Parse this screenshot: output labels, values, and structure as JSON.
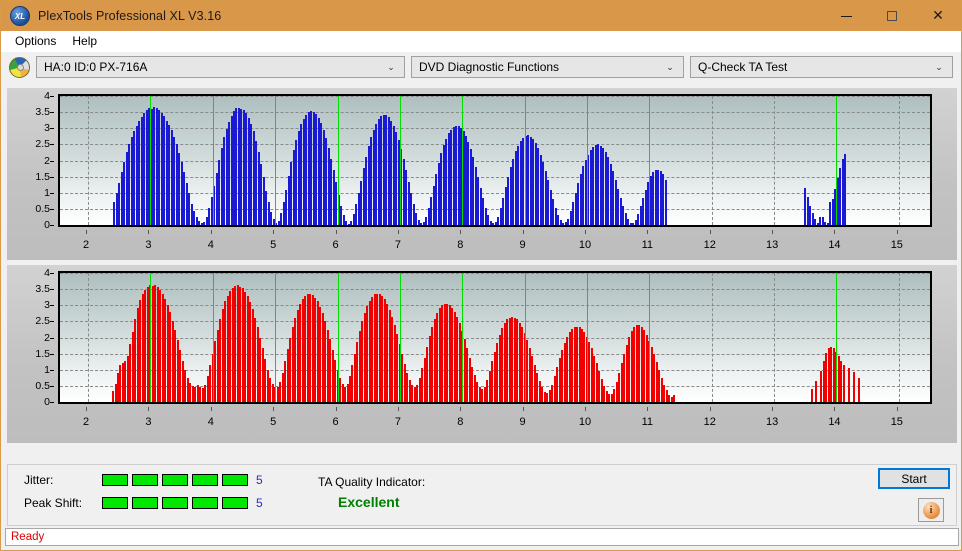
{
  "window": {
    "title": "PlexTools Professional XL V3.16",
    "app_icon": "xl-logo-icon",
    "minimize_label": "—",
    "maximize_label": "□",
    "close_label": "✕"
  },
  "menu": {
    "items": [
      {
        "label": "Options"
      },
      {
        "label": "Help"
      }
    ]
  },
  "toolbar": {
    "drive_icon": "disc-icon",
    "drive": {
      "value": "HA:0 ID:0  PX-716A",
      "arrow": "⌄"
    },
    "function": {
      "value": "DVD Diagnostic Functions",
      "arrow": "⌄"
    },
    "test": {
      "value": "Q-Check TA Test",
      "arrow": "⌄"
    }
  },
  "results": {
    "jitter_label": "Jitter:",
    "jitter_value": "5",
    "jitter_segments": 5,
    "peak_shift_label": "Peak Shift:",
    "peak_shift_value": "5",
    "peak_shift_segments": 5,
    "ta_quality_label": "TA Quality Indicator:",
    "ta_quality_value": "Excellent",
    "start_label": "Start",
    "info_glyph": "i"
  },
  "status": {
    "text": "Ready"
  },
  "colors": {
    "titlebar": "#d9974a",
    "jitter_bar": "#00e800",
    "quality_text": "#008000",
    "status_text": "#e00000",
    "top_series": "#1a1ad4",
    "bottom_series": "#f20000",
    "marker": "#00e000",
    "accent": "#0078d7"
  },
  "chart_data": [
    {
      "type": "bar",
      "title": "Jitter",
      "xlabel": "",
      "ylabel": "",
      "xlim": [
        1.55,
        15.5
      ],
      "ylim": [
        0,
        4
      ],
      "yticks": [
        0,
        0.5,
        1,
        1.5,
        2,
        2.5,
        3,
        3.5,
        4
      ],
      "xticks": [
        2,
        3,
        4,
        5,
        6,
        7,
        8,
        9,
        10,
        11,
        12,
        13,
        14,
        15
      ],
      "grid": true,
      "color": "#1a1ad4",
      "markers": [
        3,
        4,
        5,
        6,
        7,
        8,
        9,
        10,
        11,
        14
      ],
      "bar_width": 0.022,
      "x": [
        2.42,
        2.46,
        2.5,
        2.54,
        2.58,
        2.62,
        2.66,
        2.7,
        2.74,
        2.78,
        2.82,
        2.86,
        2.9,
        2.94,
        2.98,
        3.02,
        3.06,
        3.1,
        3.14,
        3.18,
        3.22,
        3.26,
        3.3,
        3.34,
        3.38,
        3.42,
        3.46,
        3.5,
        3.54,
        3.58,
        3.62,
        3.66,
        3.7,
        3.74,
        3.78,
        3.82,
        3.86,
        3.9,
        3.94,
        3.98,
        4.02,
        4.06,
        4.1,
        4.14,
        4.18,
        4.22,
        4.26,
        4.3,
        4.34,
        4.38,
        4.42,
        4.46,
        4.5,
        4.54,
        4.58,
        4.62,
        4.66,
        4.7,
        4.74,
        4.78,
        4.82,
        4.86,
        4.9,
        4.94,
        4.98,
        5.02,
        5.06,
        5.1,
        5.14,
        5.18,
        5.22,
        5.26,
        5.3,
        5.34,
        5.38,
        5.42,
        5.46,
        5.5,
        5.54,
        5.58,
        5.62,
        5.66,
        5.7,
        5.74,
        5.78,
        5.82,
        5.86,
        5.9,
        5.94,
        5.98,
        6.02,
        6.06,
        6.1,
        6.14,
        6.18,
        6.22,
        6.26,
        6.3,
        6.34,
        6.38,
        6.42,
        6.46,
        6.5,
        6.54,
        6.58,
        6.62,
        6.66,
        6.7,
        6.74,
        6.78,
        6.82,
        6.86,
        6.9,
        6.94,
        6.98,
        7.02,
        7.06,
        7.1,
        7.14,
        7.18,
        7.22,
        7.26,
        7.3,
        7.34,
        7.38,
        7.42,
        7.46,
        7.5,
        7.54,
        7.58,
        7.62,
        7.66,
        7.7,
        7.74,
        7.78,
        7.82,
        7.86,
        7.9,
        7.94,
        7.98,
        8.02,
        8.06,
        8.1,
        8.14,
        8.18,
        8.22,
        8.26,
        8.3,
        8.34,
        8.38,
        8.42,
        8.46,
        8.5,
        8.54,
        8.58,
        8.62,
        8.66,
        8.7,
        8.74,
        8.78,
        8.82,
        8.86,
        8.9,
        8.94,
        8.98,
        9.02,
        9.06,
        9.1,
        9.14,
        9.18,
        9.22,
        9.26,
        9.3,
        9.34,
        9.38,
        9.42,
        9.46,
        9.5,
        9.54,
        9.58,
        9.62,
        9.66,
        9.7,
        9.74,
        9.78,
        9.82,
        9.86,
        9.9,
        9.94,
        9.98,
        10.02,
        10.06,
        10.1,
        10.14,
        10.18,
        10.22,
        10.26,
        10.3,
        10.34,
        10.38,
        10.42,
        10.46,
        10.5,
        10.54,
        10.58,
        10.62,
        10.66,
        10.7,
        10.74,
        10.78,
        10.82,
        10.86,
        10.9,
        10.94,
        10.98,
        11.02,
        11.06,
        11.1,
        11.14,
        11.18,
        11.22,
        11.26,
        13.5,
        13.54,
        13.58,
        13.62,
        13.66,
        13.7,
        13.74,
        13.78,
        13.82,
        13.86,
        13.9,
        13.94,
        13.98,
        14.02,
        14.06,
        14.1,
        14.14
      ],
      "y": [
        0.72,
        0.98,
        1.3,
        1.64,
        1.96,
        2.26,
        2.52,
        2.72,
        2.9,
        3.06,
        3.22,
        3.36,
        3.46,
        3.56,
        3.62,
        3.6,
        3.66,
        3.62,
        3.56,
        3.48,
        3.38,
        3.24,
        3.1,
        2.94,
        2.72,
        2.5,
        2.24,
        1.96,
        1.64,
        1.3,
        0.98,
        0.66,
        0.42,
        0.26,
        0.14,
        0.06,
        0.1,
        0.26,
        0.52,
        0.86,
        1.22,
        1.62,
        2.02,
        2.4,
        2.72,
        2.98,
        3.2,
        3.38,
        3.52,
        3.62,
        3.64,
        3.6,
        3.56,
        3.46,
        3.32,
        3.14,
        2.9,
        2.6,
        2.26,
        1.88,
        1.48,
        1.06,
        0.7,
        0.4,
        0.18,
        0.06,
        0.14,
        0.38,
        0.72,
        1.1,
        1.52,
        1.94,
        2.32,
        2.64,
        2.9,
        3.12,
        3.3,
        3.42,
        3.5,
        3.52,
        3.5,
        3.44,
        3.32,
        3.16,
        2.96,
        2.7,
        2.4,
        2.06,
        1.7,
        1.32,
        0.94,
        0.6,
        0.32,
        0.12,
        0.04,
        0.12,
        0.34,
        0.64,
        1.0,
        1.38,
        1.76,
        2.12,
        2.44,
        2.72,
        2.96,
        3.14,
        3.28,
        3.38,
        3.42,
        3.4,
        3.34,
        3.24,
        3.08,
        2.88,
        2.64,
        2.36,
        2.04,
        1.7,
        1.34,
        1.0,
        0.66,
        0.36,
        0.16,
        0.06,
        0.1,
        0.26,
        0.52,
        0.86,
        1.22,
        1.58,
        1.92,
        2.22,
        2.48,
        2.68,
        2.84,
        2.96,
        3.04,
        3.08,
        3.06,
        3.0,
        2.9,
        2.76,
        2.58,
        2.36,
        2.1,
        1.8,
        1.48,
        1.16,
        0.84,
        0.54,
        0.3,
        0.14,
        0.06,
        0.1,
        0.26,
        0.52,
        0.84,
        1.18,
        1.5,
        1.8,
        2.06,
        2.28,
        2.46,
        2.6,
        2.7,
        2.76,
        2.78,
        2.74,
        2.66,
        2.54,
        2.38,
        2.18,
        1.94,
        1.68,
        1.4,
        1.1,
        0.82,
        0.54,
        0.32,
        0.16,
        0.06,
        0.08,
        0.2,
        0.42,
        0.7,
        1.0,
        1.3,
        1.58,
        1.82,
        2.02,
        2.18,
        2.32,
        2.42,
        2.48,
        2.5,
        2.46,
        2.38,
        2.26,
        2.1,
        1.9,
        1.66,
        1.4,
        1.12,
        0.84,
        0.58,
        0.36,
        0.18,
        0.06,
        0.06,
        0.16,
        0.34,
        0.58,
        0.84,
        1.1,
        1.34,
        1.52,
        1.64,
        1.7,
        1.72,
        1.68,
        1.58,
        1.4,
        1.16,
        0.88,
        0.6,
        0.36,
        0.18,
        0.06,
        0.24,
        0.26,
        0.1,
        0.06,
        0.7,
        0.8,
        1.12,
        1.46,
        1.78,
        2.04,
        2.2,
        2.16,
        2.06,
        1.92,
        1.74,
        1.52,
        1.28,
        1.02,
        0.72,
        0.28,
        0.14
      ]
    },
    {
      "type": "bar",
      "title": "Peak Shift",
      "xlabel": "",
      "ylabel": "",
      "xlim": [
        1.55,
        15.5
      ],
      "ylim": [
        0,
        4
      ],
      "yticks": [
        0,
        0.5,
        1,
        1.5,
        2,
        2.5,
        3,
        3.5,
        4
      ],
      "xticks": [
        2,
        3,
        4,
        5,
        6,
        7,
        8,
        9,
        10,
        11,
        12,
        13,
        14,
        15
      ],
      "grid": true,
      "color": "#f20000",
      "markers": [
        3,
        4,
        5,
        6,
        7,
        8,
        9,
        10,
        11,
        14
      ],
      "bar_width": 0.03,
      "x": [
        2.4,
        2.44,
        2.48,
        2.52,
        2.56,
        2.6,
        2.64,
        2.68,
        2.72,
        2.76,
        2.8,
        2.84,
        2.88,
        2.92,
        2.96,
        3.0,
        3.04,
        3.08,
        3.12,
        3.16,
        3.2,
        3.24,
        3.28,
        3.32,
        3.36,
        3.4,
        3.44,
        3.48,
        3.52,
        3.56,
        3.6,
        3.64,
        3.68,
        3.72,
        3.76,
        3.8,
        3.84,
        3.88,
        3.92,
        3.96,
        4.0,
        4.04,
        4.08,
        4.12,
        4.16,
        4.2,
        4.24,
        4.28,
        4.32,
        4.36,
        4.4,
        4.44,
        4.48,
        4.52,
        4.56,
        4.6,
        4.64,
        4.68,
        4.72,
        4.76,
        4.8,
        4.84,
        4.88,
        4.92,
        4.96,
        5.0,
        5.04,
        5.08,
        5.12,
        5.16,
        5.2,
        5.24,
        5.28,
        5.32,
        5.36,
        5.4,
        5.44,
        5.48,
        5.52,
        5.56,
        5.6,
        5.64,
        5.68,
        5.72,
        5.76,
        5.8,
        5.84,
        5.88,
        5.92,
        5.96,
        6.0,
        6.04,
        6.08,
        6.12,
        6.16,
        6.2,
        6.24,
        6.28,
        6.32,
        6.36,
        6.4,
        6.44,
        6.48,
        6.52,
        6.56,
        6.6,
        6.64,
        6.68,
        6.72,
        6.76,
        6.8,
        6.84,
        6.88,
        6.92,
        6.96,
        7.0,
        7.04,
        7.08,
        7.12,
        7.16,
        7.2,
        7.24,
        7.28,
        7.32,
        7.36,
        7.4,
        7.44,
        7.48,
        7.52,
        7.56,
        7.6,
        7.64,
        7.68,
        7.72,
        7.76,
        7.8,
        7.84,
        7.88,
        7.92,
        7.96,
        8.0,
        8.04,
        8.08,
        8.12,
        8.16,
        8.2,
        8.24,
        8.28,
        8.32,
        8.36,
        8.4,
        8.44,
        8.48,
        8.52,
        8.56,
        8.6,
        8.64,
        8.68,
        8.72,
        8.76,
        8.8,
        8.84,
        8.88,
        8.92,
        8.96,
        9.0,
        9.04,
        9.08,
        9.12,
        9.16,
        9.2,
        9.24,
        9.28,
        9.32,
        9.36,
        9.4,
        9.44,
        9.48,
        9.52,
        9.56,
        9.6,
        9.64,
        9.68,
        9.72,
        9.76,
        9.8,
        9.84,
        9.88,
        9.92,
        9.96,
        10.0,
        10.04,
        10.08,
        10.12,
        10.16,
        10.2,
        10.24,
        10.28,
        10.32,
        10.36,
        10.4,
        10.44,
        10.48,
        10.52,
        10.56,
        10.6,
        10.64,
        10.68,
        10.72,
        10.76,
        10.8,
        10.84,
        10.88,
        10.92,
        10.96,
        11.0,
        11.04,
        11.08,
        11.12,
        11.16,
        11.2,
        11.24,
        11.28,
        11.32,
        11.36,
        11.4,
        13.6,
        13.68,
        13.76,
        13.8,
        13.84,
        13.88,
        13.92,
        13.96,
        14.0,
        14.04,
        14.08,
        14.12,
        14.2,
        14.28,
        14.36
      ],
      "y": [
        0.34,
        0.56,
        0.9,
        1.14,
        1.22,
        1.26,
        1.42,
        1.8,
        2.18,
        2.56,
        2.9,
        3.16,
        3.34,
        3.48,
        3.56,
        3.62,
        3.6,
        3.62,
        3.56,
        3.46,
        3.34,
        3.18,
        3.0,
        2.78,
        2.52,
        2.24,
        1.92,
        1.6,
        1.28,
        0.98,
        0.74,
        0.58,
        0.5,
        0.48,
        0.52,
        0.46,
        0.42,
        0.52,
        0.8,
        1.14,
        1.5,
        1.88,
        2.24,
        2.58,
        2.88,
        3.12,
        3.3,
        3.44,
        3.54,
        3.6,
        3.62,
        3.58,
        3.52,
        3.42,
        3.28,
        3.1,
        2.88,
        2.62,
        2.32,
        2.0,
        1.66,
        1.32,
        1.0,
        0.74,
        0.56,
        0.46,
        0.48,
        0.62,
        0.9,
        1.26,
        1.64,
        2.0,
        2.34,
        2.62,
        2.86,
        3.04,
        3.18,
        3.28,
        3.34,
        3.36,
        3.32,
        3.24,
        3.12,
        2.96,
        2.76,
        2.52,
        2.24,
        1.94,
        1.62,
        1.3,
        1.0,
        0.74,
        0.56,
        0.48,
        0.56,
        0.8,
        1.14,
        1.5,
        1.86,
        2.2,
        2.5,
        2.76,
        2.98,
        3.14,
        3.26,
        3.34,
        3.36,
        3.34,
        3.28,
        3.18,
        3.04,
        2.86,
        2.64,
        2.38,
        2.1,
        1.8,
        1.48,
        1.18,
        0.9,
        0.68,
        0.52,
        0.46,
        0.54,
        0.74,
        1.04,
        1.38,
        1.72,
        2.04,
        2.32,
        2.56,
        2.76,
        2.9,
        3.0,
        3.04,
        3.04,
        3.0,
        2.92,
        2.8,
        2.64,
        2.44,
        2.2,
        1.94,
        1.66,
        1.38,
        1.1,
        0.84,
        0.62,
        0.46,
        0.4,
        0.48,
        0.68,
        0.96,
        1.26,
        1.56,
        1.84,
        2.08,
        2.28,
        2.44,
        2.56,
        2.62,
        2.64,
        2.62,
        2.56,
        2.46,
        2.32,
        2.14,
        1.92,
        1.68,
        1.42,
        1.16,
        0.9,
        0.66,
        0.46,
        0.32,
        0.28,
        0.36,
        0.54,
        0.8,
        1.08,
        1.36,
        1.62,
        1.84,
        2.02,
        2.16,
        2.26,
        2.32,
        2.34,
        2.32,
        2.26,
        2.16,
        2.02,
        1.86,
        1.66,
        1.44,
        1.2,
        0.96,
        0.72,
        0.5,
        0.34,
        0.24,
        0.26,
        0.4,
        0.62,
        0.9,
        1.2,
        1.5,
        1.78,
        2.02,
        2.2,
        2.32,
        2.38,
        2.38,
        2.32,
        2.22,
        2.08,
        1.9,
        1.7,
        1.48,
        1.24,
        1.0,
        0.76,
        0.54,
        0.36,
        0.22,
        0.16,
        0.22,
        0.4,
        0.66,
        0.96,
        1.26,
        1.52,
        1.68,
        1.72,
        1.66,
        1.56,
        1.42,
        1.28,
        1.16,
        1.04,
        0.92,
        0.74,
        0.46,
        0.22,
        0.16,
        0.14,
        0.46,
        0.74,
        1.12,
        1.22,
        1.1,
        1.0,
        0.96,
        0.56,
        0.18,
        0.18,
        0.16,
        0.14
      ]
    }
  ]
}
